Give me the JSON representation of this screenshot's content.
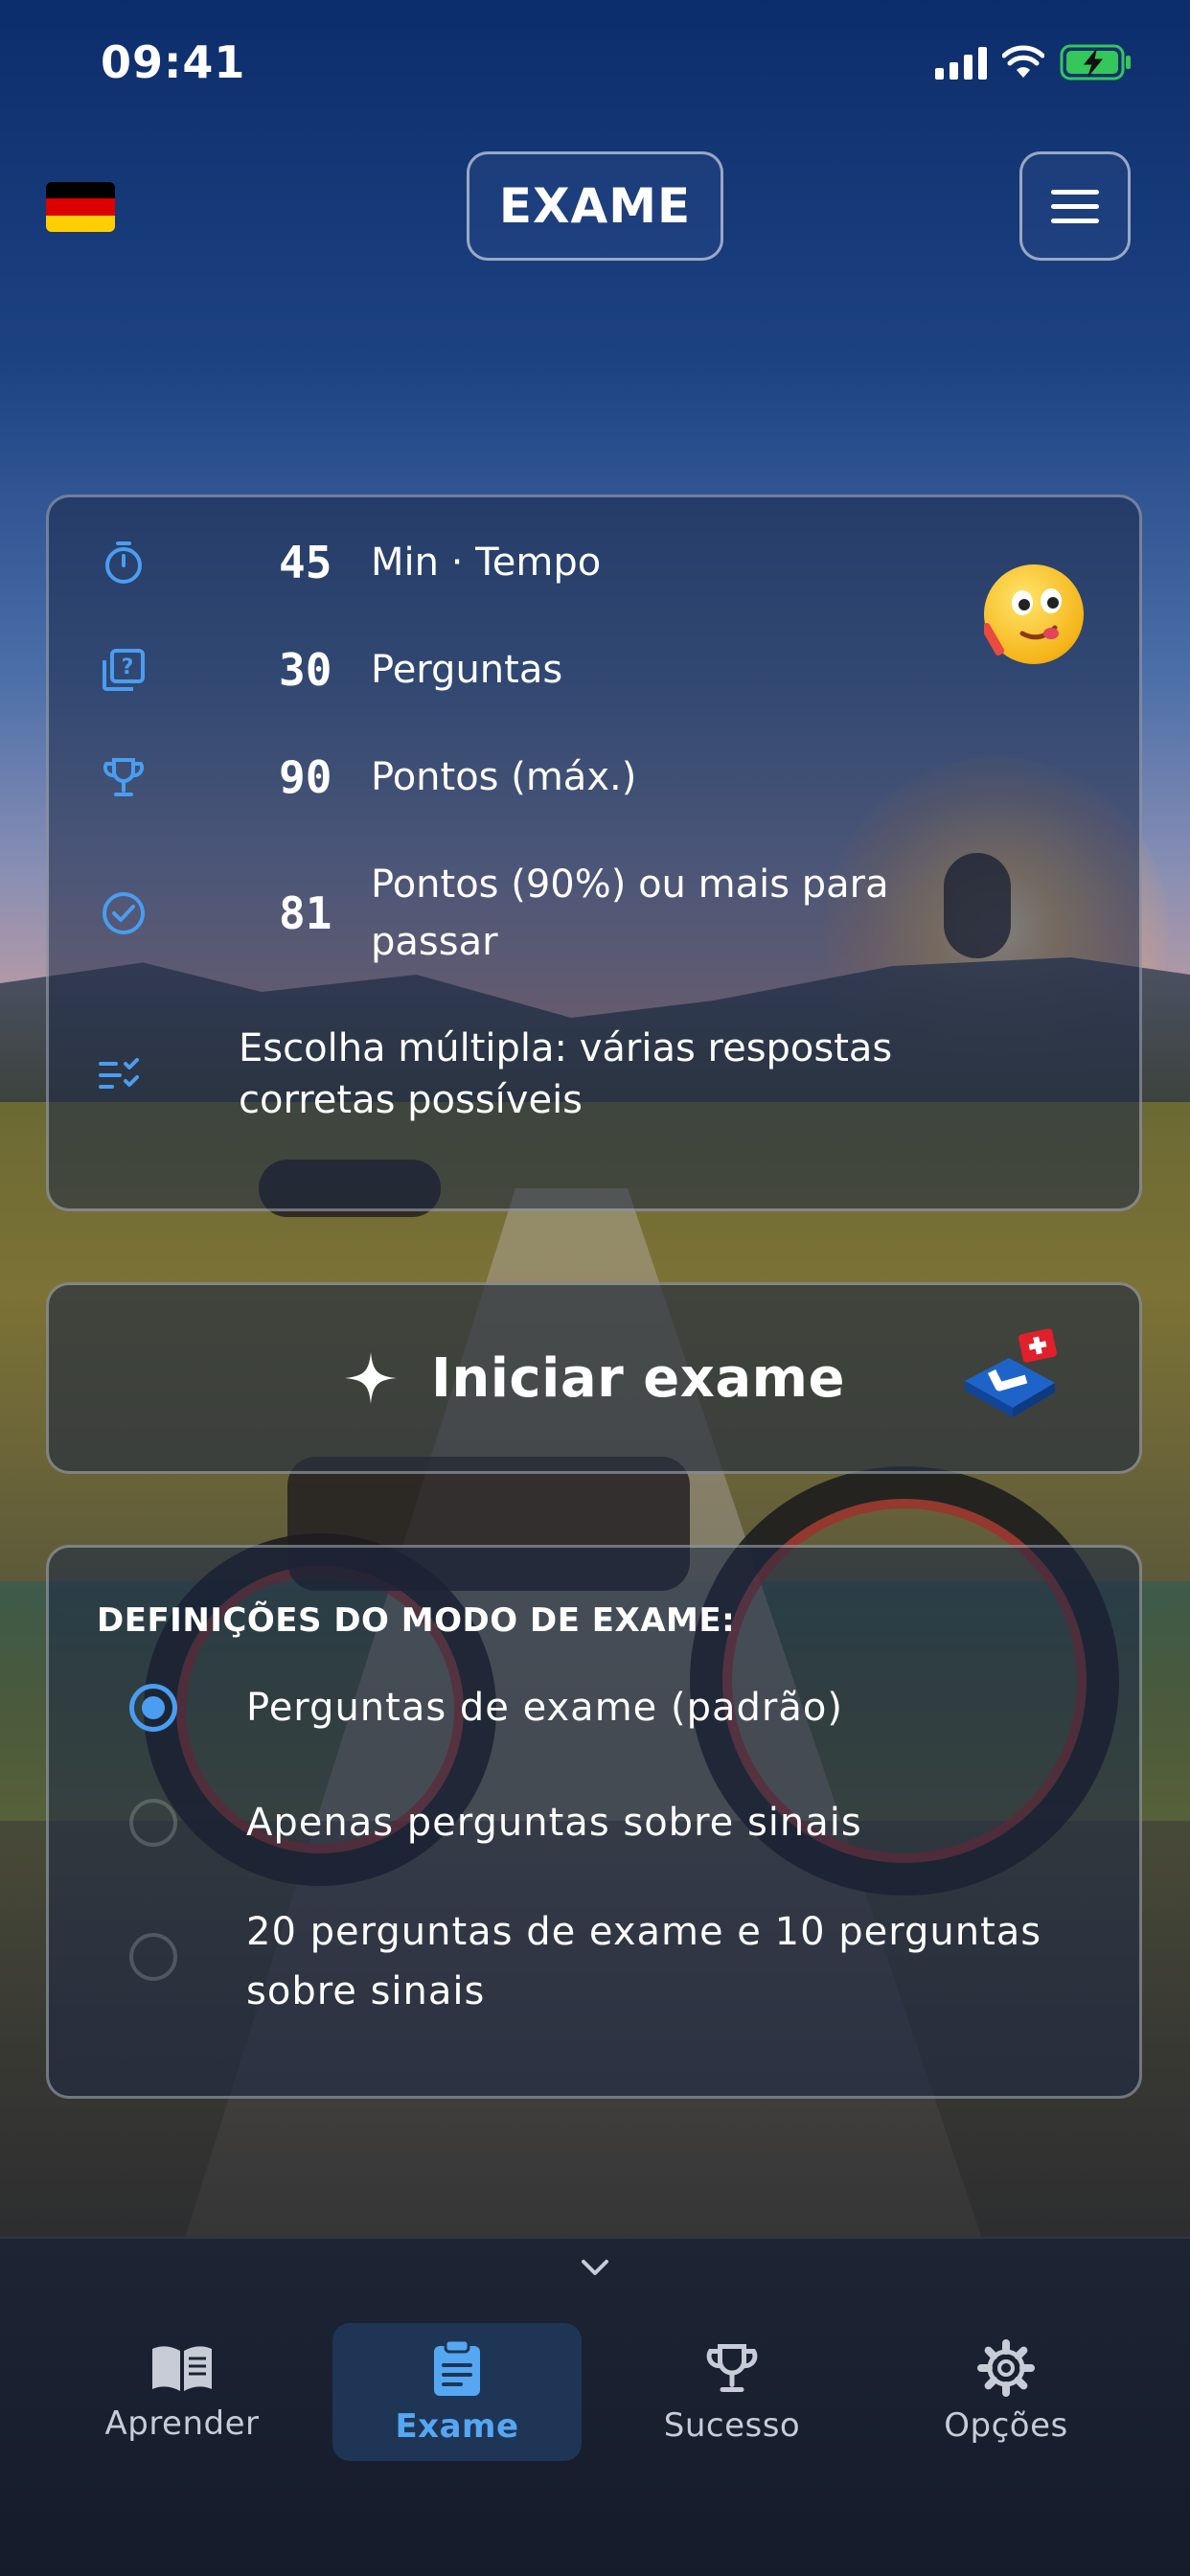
{
  "status_bar": {
    "time": "09:41"
  },
  "header": {
    "title": "EXAME",
    "flag": "germany-flag",
    "colors": {
      "flag": [
        "#000000",
        "#dd0000",
        "#ffce00"
      ]
    }
  },
  "exam_info": {
    "rows": [
      {
        "icon": "stopwatch-icon",
        "value": "45",
        "label": "Min · Tempo"
      },
      {
        "icon": "question-card-icon",
        "value": "30",
        "label": "Perguntas"
      },
      {
        "icon": "trophy-icon",
        "value": "90",
        "label": "Pontos (máx.)"
      },
      {
        "icon": "check-circle-icon",
        "value": "81",
        "label": "Pontos (90%) ou mais para",
        "label2": "passar"
      }
    ],
    "multiple_choice": {
      "icon": "checklist-icon",
      "line1": "Escolha múltipla: várias respostas",
      "line2": "corretas possíveis"
    }
  },
  "start_button": {
    "label": "Iniciar exame",
    "icon": "sparkle-icon",
    "logo": "swiss-license-logo"
  },
  "settings": {
    "title": "DEFINIÇÕES DO MODO DE EXAME:",
    "options": [
      {
        "line1": "Perguntas de exame (padrão)",
        "line2": "",
        "selected": true
      },
      {
        "line1": "Apenas perguntas sobre sinais",
        "line2": "",
        "selected": false
      },
      {
        "line1": "20 perguntas de exame e 10 perguntas",
        "line2": "sobre sinais",
        "selected": false
      }
    ]
  },
  "tabbar": {
    "tabs": [
      {
        "label": "Aprender",
        "icon": "open-book-icon",
        "active": false
      },
      {
        "label": "Exame",
        "icon": "clipboard-icon",
        "active": true
      },
      {
        "label": "Sucesso",
        "icon": "trophy-icon",
        "active": false
      },
      {
        "label": "Opções",
        "icon": "gear-icon",
        "active": false
      }
    ],
    "colors": {
      "active": "#55a7f2",
      "inactive": "#c7ccd6"
    }
  }
}
